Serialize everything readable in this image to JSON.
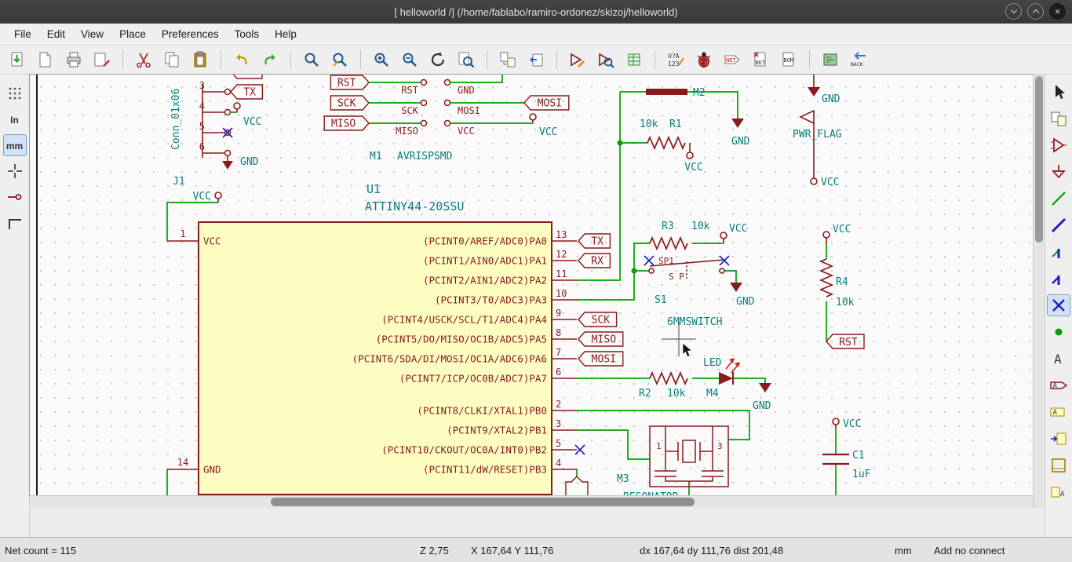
{
  "window": {
    "title": "[ helloworld /] (/home/fablabo/ramiro-ordonez/skizoj/helloworld)"
  },
  "menu": {
    "items": [
      "File",
      "Edit",
      "View",
      "Place",
      "Preferences",
      "Tools",
      "Help"
    ]
  },
  "toolbar": {
    "annotate_top": "U?A",
    "annotate_bottom": "123",
    "netlist": "NET",
    "cvpcb_net": "NET",
    "bom": "BOM",
    "back": "BACK"
  },
  "left_toolbar": {
    "inches": "In",
    "mm": "mm"
  },
  "statusbar": {
    "net_count": "Net count = 115",
    "zoom": "Z 2,75",
    "position": "X 167,64 Y 111,76",
    "delta": "dx 167,64 dy 111,76 dist 201,48",
    "units": "mm",
    "tool": "Add no connect"
  },
  "colors": {
    "wire": "#00a000",
    "bus": "#1d1dc8",
    "component": "#8a1a1b",
    "fields": "#0b7c7c",
    "body_fill": "#fdfdc2",
    "no_connect": "#1d1dc8"
  },
  "schematic": {
    "u1": {
      "ref": "U1",
      "value": "ATTINY44-20SSU",
      "left_pins": [
        {
          "num": "1",
          "name": "VCC"
        },
        {
          "num": "14",
          "name": "GND"
        }
      ],
      "right_pins": [
        {
          "num": "13",
          "name": "(PCINT0/AREF/ADC0)PA0",
          "label": "TX"
        },
        {
          "num": "12",
          "name": "(PCINT1/AIN0/ADC1)PA1",
          "label": "RX"
        },
        {
          "num": "11",
          "name": "(PCINT2/AIN1/ADC2)PA2"
        },
        {
          "num": "10",
          "name": "(PCINT3/T0/ADC3)PA3"
        },
        {
          "num": "9",
          "name": "(PCINT4/USCK/SCL/T1/ADC4)PA4",
          "label": "SCK"
        },
        {
          "num": "8",
          "name": "(PCINT5/DO/MISO/OC1B/ADC5)PA5",
          "label": "MISO"
        },
        {
          "num": "7",
          "name": "(PCINT6/SDA/DI/MOSI/OC1A/ADC6)PA6",
          "label": "MOSI"
        },
        {
          "num": "6",
          "name": "(PCINT7/ICP/OC0B/ADC7)PA7"
        },
        {
          "num": "2",
          "name": "(PCINT8/CLKI/XTAL1)PB0"
        },
        {
          "num": "3",
          "name": "(PCINT9/XTAL2)PB1"
        },
        {
          "num": "5",
          "name": "(PCINT10/CKOUT/OC0A/INT0)PB2",
          "nc": true
        },
        {
          "num": "4",
          "name": "(PCINT11/dW/RESET)PB3"
        }
      ]
    },
    "j1": {
      "ref": "J1",
      "value": "Conn_01x06",
      "pins": [
        {
          "num": "3",
          "label": "TX"
        },
        {
          "num": "4",
          "net": "VCC"
        },
        {
          "num": "5",
          "nc": true
        },
        {
          "num": "6",
          "net": "GND"
        }
      ]
    },
    "m1": {
      "ref": "M1",
      "value": "AVRISPSMD",
      "left": [
        {
          "label": "RST",
          "name": "RST"
        },
        {
          "label": "SCK",
          "name": "SCK"
        },
        {
          "label": "MISO",
          "name": "MISO"
        }
      ],
      "right": [
        {
          "name": "GND"
        },
        {
          "name": "MOSI",
          "label": "MOSI"
        },
        {
          "name": "VCC",
          "vcc": "VCC"
        }
      ]
    },
    "m2": {
      "ref": "M2",
      "gnd": "GND"
    },
    "r1": {
      "ref": "R1",
      "value": "10k",
      "vcc": "VCC"
    },
    "pwr": {
      "flag": "PWR_FLAG",
      "gnd": "GND",
      "vcc": "VCC"
    },
    "r3": {
      "ref": "R3",
      "value": "10k",
      "vcc": "VCC"
    },
    "s1": {
      "ref": "S1",
      "value": "6MMSWITCH",
      "t1": "SP1",
      "t2": "S P",
      "gnd": "GND"
    },
    "r4": {
      "ref": "R4",
      "value": "10k",
      "vcc": "VCC",
      "label": "RST"
    },
    "r2": {
      "ref": "R2",
      "value": "10k"
    },
    "m4": {
      "ref": "M4",
      "value": "LED",
      "gnd": "GND"
    },
    "m3": {
      "ref": "M3",
      "value": "RESONATOR",
      "p1": "1",
      "p3": "3"
    },
    "c1": {
      "ref": "C1",
      "value": "1uF",
      "vcc": "VCC"
    },
    "misc": {
      "vcc_pin1": "VCC"
    }
  }
}
